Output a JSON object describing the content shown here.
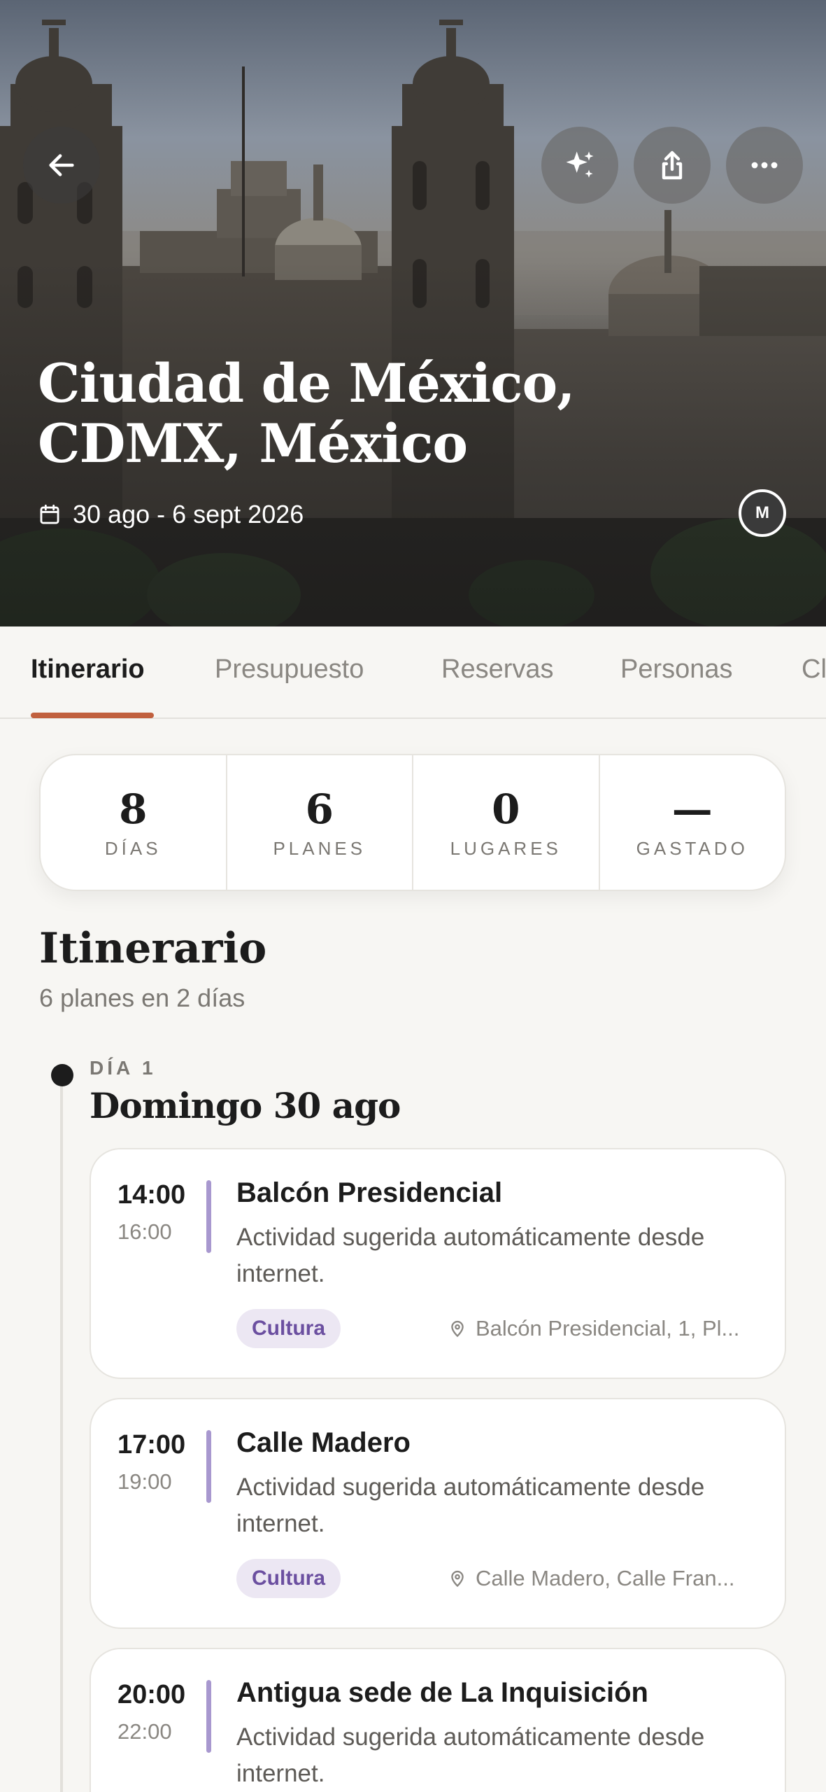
{
  "hero": {
    "title": "Ciudad de México, CDMX, México",
    "dates": "30 ago - 6 sept 2026",
    "avatar_initial": "M"
  },
  "actions": {
    "back_icon": "arrow-left-icon",
    "sparkle_icon": "sparkle-icon",
    "share_icon": "share-icon",
    "more_icon": "more-horizontal-icon"
  },
  "tabs": [
    {
      "label": "Itinerario",
      "active": true
    },
    {
      "label": "Presupuesto",
      "active": false
    },
    {
      "label": "Reservas",
      "active": false
    },
    {
      "label": "Personas",
      "active": false
    },
    {
      "label": "Cl",
      "active": false
    }
  ],
  "stats": [
    {
      "value": "8",
      "label": "DÍAS"
    },
    {
      "value": "6",
      "label": "PLANES"
    },
    {
      "value": "0",
      "label": "LUGARES"
    },
    {
      "value": "—",
      "label": "GASTADO"
    }
  ],
  "itinerary": {
    "title": "Itinerario",
    "subtitle": "6 planes en 2 días",
    "days": [
      {
        "label": "DÍA 1",
        "title": "Domingo 30 ago",
        "plans": [
          {
            "start": "14:00",
            "end": "16:00",
            "title": "Balcón Presidencial",
            "description": "Actividad sugerida automáticamente desde internet.",
            "tag": "Cultura",
            "location": "Balcón Presidencial, 1, Pl..."
          },
          {
            "start": "17:00",
            "end": "19:00",
            "title": "Calle Madero",
            "description": "Actividad sugerida automáticamente desde internet.",
            "tag": "Cultura",
            "location": "Calle Madero, Calle Fran..."
          },
          {
            "start": "20:00",
            "end": "22:00",
            "title": "Antigua sede de La Inquisición",
            "description": "Actividad sugerida automáticamente desde internet.",
            "tag": "",
            "location": ""
          }
        ]
      }
    ]
  },
  "colors": {
    "accent": "#c1603e",
    "tag_bg": "#ece7f3",
    "tag_text": "#6b4fa0",
    "time_bar": "#a898cf",
    "background": "#f7f6f3"
  }
}
